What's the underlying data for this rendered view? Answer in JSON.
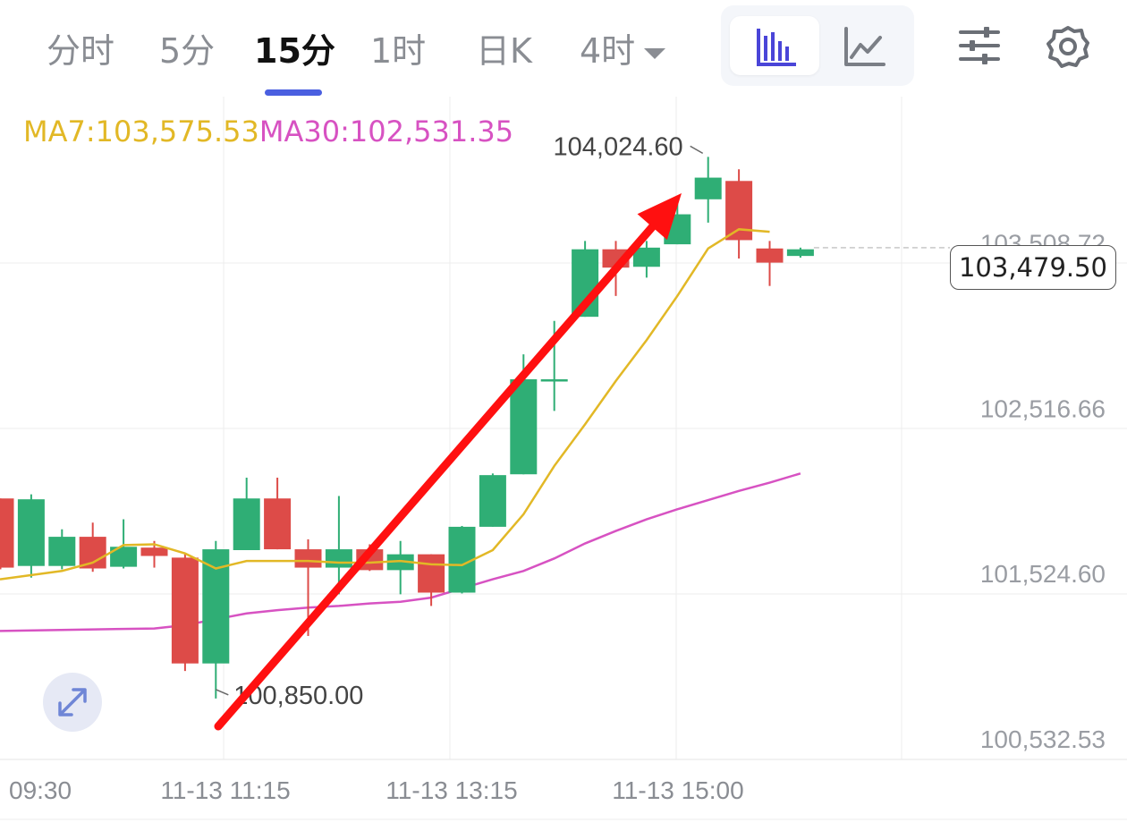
{
  "toolbar": {
    "tabs": [
      {
        "label": "分时"
      },
      {
        "label": "5分"
      },
      {
        "label": "15分",
        "active": true
      },
      {
        "label": "1时"
      },
      {
        "label": "日K"
      },
      {
        "label": "4时",
        "dropdown": true
      }
    ],
    "icons": [
      "candlestick-chart-icon",
      "line-chart-icon",
      "indicator-settings-icon",
      "gear-icon",
      "expand-icon"
    ]
  },
  "legend": {
    "ma7": "MA7:103,575.53",
    "ma30": "MA30:102,531.35"
  },
  "colors": {
    "up": "#2fae75",
    "down": "#dd4b48",
    "ma7": "#e2b826",
    "ma30": "#d752c2",
    "accent": "#4a5fe0",
    "annotation_arrow": "#ff1010"
  },
  "chart_data": {
    "type": "candlestick",
    "interval": "15分",
    "y_ticks": [
      "103,508.72",
      "102,516.66",
      "101,524.60",
      "100,532.53"
    ],
    "x_ticks": [
      "09:30",
      "11-13 11:15",
      "11-13 13:15",
      "11-13 15:00"
    ],
    "last_price": "103,479.50",
    "high_label": "104,024.60",
    "low_label": "100,850.00",
    "annotation": "red arrow from 100,850.00 low up to 104,024.60 high",
    "candles": [
      {
        "o": 101975,
        "h": 101975,
        "l": 101550,
        "c": 101560
      },
      {
        "o": 101570,
        "h": 102000,
        "l": 101500,
        "c": 101970
      },
      {
        "o": 101570,
        "h": 101790,
        "l": 101550,
        "c": 101745
      },
      {
        "o": 101745,
        "h": 101830,
        "l": 101535,
        "c": 101555
      },
      {
        "o": 101565,
        "h": 101850,
        "l": 101555,
        "c": 101685
      },
      {
        "o": 101680,
        "h": 101720,
        "l": 101560,
        "c": 101630
      },
      {
        "o": 101620,
        "h": 101645,
        "l": 100940,
        "c": 100985
      },
      {
        "o": 100985,
        "h": 101720,
        "l": 100775,
        "c": 101670
      },
      {
        "o": 101665,
        "h": 102100,
        "l": 101665,
        "c": 101975
      },
      {
        "o": 101975,
        "h": 102100,
        "l": 101670,
        "c": 101670
      },
      {
        "o": 101670,
        "h": 101730,
        "l": 101150,
        "c": 101560
      },
      {
        "o": 101560,
        "h": 101990,
        "l": 101400,
        "c": 101670
      },
      {
        "o": 101670,
        "h": 101700,
        "l": 101540,
        "c": 101545
      },
      {
        "o": 101545,
        "h": 101720,
        "l": 101400,
        "c": 101640
      },
      {
        "o": 101640,
        "h": 101640,
        "l": 101330,
        "c": 101410
      },
      {
        "o": 101410,
        "h": 101810,
        "l": 101405,
        "c": 101805
      },
      {
        "o": 101805,
        "h": 102125,
        "l": 101805,
        "c": 102115
      },
      {
        "o": 102120,
        "h": 102840,
        "l": 102120,
        "c": 102690
      },
      {
        "o": 102690,
        "h": 103040,
        "l": 102500,
        "c": 102690
      },
      {
        "o": 103065,
        "h": 103520,
        "l": 103065,
        "c": 103470
      },
      {
        "o": 103470,
        "h": 103520,
        "l": 103190,
        "c": 103360
      },
      {
        "o": 103365,
        "h": 103520,
        "l": 103300,
        "c": 103480
      },
      {
        "o": 103500,
        "h": 103780,
        "l": 103500,
        "c": 103680
      },
      {
        "o": 103770,
        "h": 104024.6,
        "l": 103630,
        "c": 103900
      },
      {
        "o": 103880,
        "h": 103950,
        "l": 103415,
        "c": 103525
      },
      {
        "o": 103475,
        "h": 103520,
        "l": 103250,
        "c": 103390
      },
      {
        "o": 103430,
        "h": 103480,
        "l": 103420,
        "c": 103470
      }
    ],
    "ma7": [
      101490,
      101540,
      101590,
      101695,
      101700,
      101645,
      101555,
      101600,
      101600,
      101600,
      101590,
      101590,
      101600,
      101580,
      101575,
      101665,
      101880,
      102170,
      102420,
      102680,
      102925,
      103190,
      103475,
      103590,
      103575
    ],
    "ma30": [
      101180,
      101195,
      101215,
      101250,
      101285,
      101305,
      101320,
      101330,
      101345,
      101355,
      101380,
      101435,
      101490,
      101540,
      101615,
      101705,
      101780,
      101850,
      101910,
      101965,
      102020,
      102070,
      102125
    ],
    "ma30_start_index": 4
  }
}
